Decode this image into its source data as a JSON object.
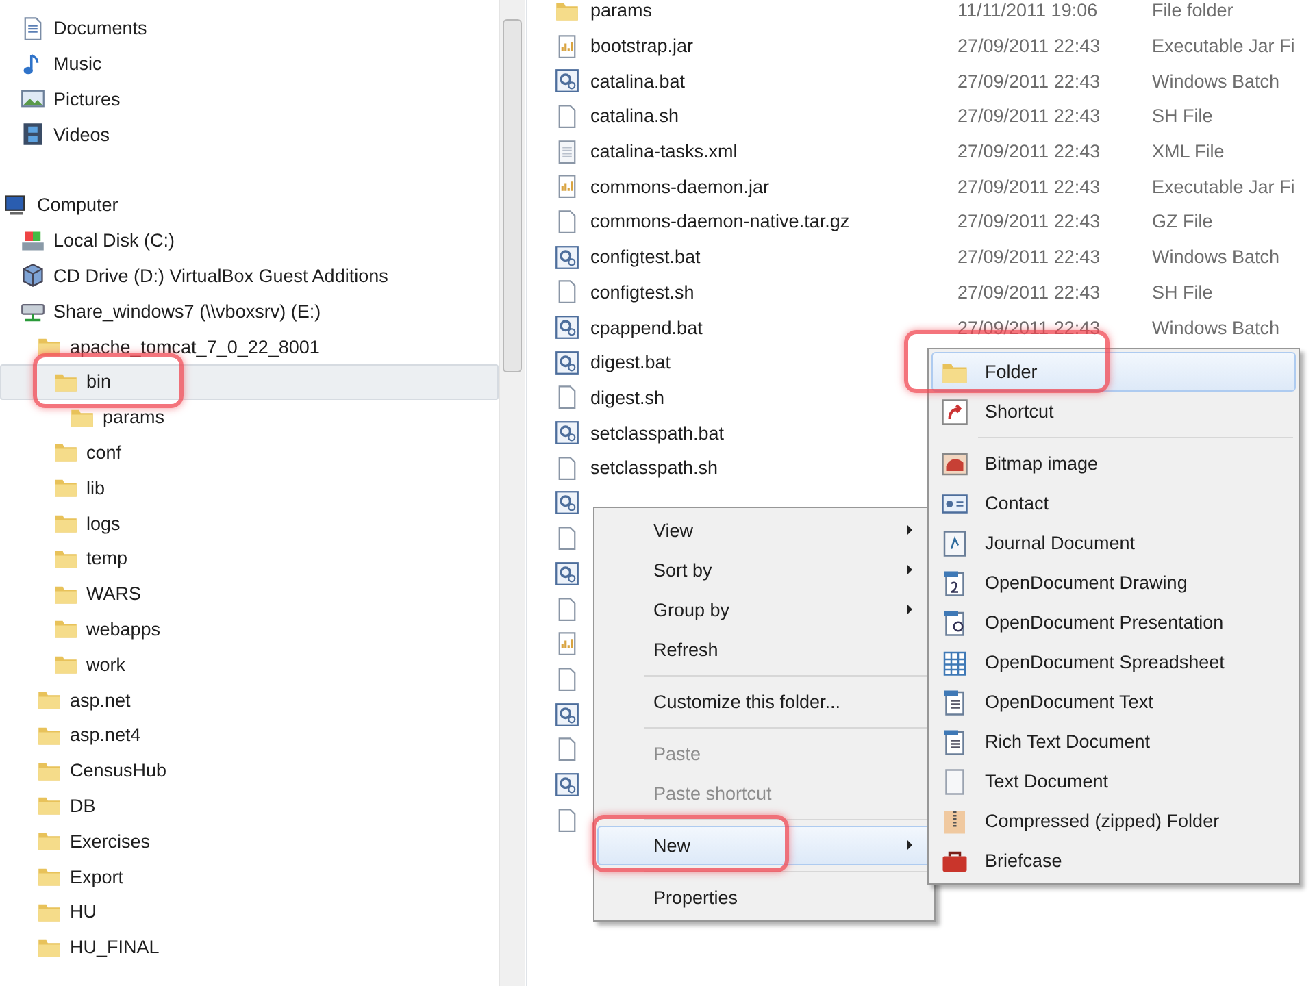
{
  "libraries_items": [
    {
      "label": "Documents",
      "kind": "document",
      "selected": false
    },
    {
      "label": "Music",
      "kind": "music",
      "selected": false
    },
    {
      "label": "Pictures",
      "kind": "pictures",
      "selected": false
    },
    {
      "label": "Videos",
      "kind": "videos",
      "selected": false
    }
  ],
  "computer": {
    "label": "Computer",
    "kind": "computer",
    "selected": false,
    "children": [
      {
        "label": "Local Disk (C:)",
        "kind": "disk",
        "selected": false
      },
      {
        "label": "CD Drive (D:) VirtualBox Guest Additions",
        "kind": "cd",
        "selected": false
      },
      {
        "label": "Share_windows7 (\\\\vboxsrv) (E:)",
        "kind": "network",
        "selected": false,
        "children": [
          {
            "label": "apache_tomcat_7_0_22_8001",
            "kind": "folder",
            "selected": false,
            "children": [
              {
                "label": "bin",
                "kind": "folder",
                "selected": true,
                "annotated": true,
                "children": [
                  {
                    "label": "params",
                    "kind": "folder",
                    "selected": false
                  }
                ]
              },
              {
                "label": "conf",
                "kind": "folder",
                "selected": false
              },
              {
                "label": "lib",
                "kind": "folder",
                "selected": false
              },
              {
                "label": "logs",
                "kind": "folder",
                "selected": false
              },
              {
                "label": "temp",
                "kind": "folder",
                "selected": false
              },
              {
                "label": "WARS",
                "kind": "folder",
                "selected": false
              },
              {
                "label": "webapps",
                "kind": "folder",
                "selected": false
              },
              {
                "label": "work",
                "kind": "folder",
                "selected": false
              }
            ]
          },
          {
            "label": "asp.net",
            "kind": "folder",
            "selected": false
          },
          {
            "label": "asp.net4",
            "kind": "folder",
            "selected": false
          },
          {
            "label": "CensusHub",
            "kind": "folder",
            "selected": false
          },
          {
            "label": "DB",
            "kind": "folder",
            "selected": false
          },
          {
            "label": "Exercises",
            "kind": "folder",
            "selected": false
          },
          {
            "label": "Export",
            "kind": "folder",
            "selected": false
          },
          {
            "label": "HU",
            "kind": "folder",
            "selected": false
          },
          {
            "label": "HU_FINAL",
            "kind": "folder",
            "selected": false
          }
        ]
      }
    ]
  },
  "files": [
    {
      "kind": "folder",
      "name": "params",
      "date": "11/11/2011 19:06",
      "type": "File folder"
    },
    {
      "kind": "jar",
      "name": "bootstrap.jar",
      "date": "27/09/2011 22:43",
      "type": "Executable Jar Fi"
    },
    {
      "kind": "bat",
      "name": "catalina.bat",
      "date": "27/09/2011 22:43",
      "type": "Windows Batch"
    },
    {
      "kind": "blank",
      "name": "catalina.sh",
      "date": "27/09/2011 22:43",
      "type": "SH File"
    },
    {
      "kind": "xml",
      "name": "catalina-tasks.xml",
      "date": "27/09/2011 22:43",
      "type": "XML File"
    },
    {
      "kind": "jar",
      "name": "commons-daemon.jar",
      "date": "27/09/2011 22:43",
      "type": "Executable Jar Fi"
    },
    {
      "kind": "blank",
      "name": "commons-daemon-native.tar.gz",
      "date": "27/09/2011 22:43",
      "type": "GZ File"
    },
    {
      "kind": "bat",
      "name": "configtest.bat",
      "date": "27/09/2011 22:43",
      "type": "Windows Batch"
    },
    {
      "kind": "blank",
      "name": "configtest.sh",
      "date": "27/09/2011 22:43",
      "type": "SH File"
    },
    {
      "kind": "bat",
      "name": "cpappend.bat",
      "date": "27/09/2011 22:43",
      "type": "Windows Batch"
    },
    {
      "kind": "bat",
      "name": "digest.bat"
    },
    {
      "kind": "blank",
      "name": "digest.sh"
    },
    {
      "kind": "bat",
      "name": "setclasspath.bat"
    },
    {
      "kind": "blank",
      "name": "setclasspath.sh"
    },
    {
      "kind": "bat"
    },
    {
      "kind": "blank"
    },
    {
      "kind": "bat"
    },
    {
      "kind": "blank"
    },
    {
      "kind": "jar"
    },
    {
      "kind": "blank"
    },
    {
      "kind": "bat"
    },
    {
      "kind": "blank"
    },
    {
      "kind": "bat"
    },
    {
      "kind": "blank"
    }
  ],
  "context_menu": [
    {
      "kind": "item",
      "label": "View",
      "submenu": true,
      "disabled": false,
      "selected": false
    },
    {
      "kind": "item",
      "label": "Sort by",
      "submenu": true,
      "disabled": false,
      "selected": false
    },
    {
      "kind": "item",
      "label": "Group by",
      "submenu": true,
      "disabled": false,
      "selected": false
    },
    {
      "kind": "item",
      "label": "Refresh",
      "submenu": false,
      "disabled": false,
      "selected": false
    },
    {
      "kind": "separator"
    },
    {
      "kind": "item",
      "label": "Customize this folder...",
      "submenu": false,
      "disabled": false,
      "selected": false
    },
    {
      "kind": "separator"
    },
    {
      "kind": "item",
      "label": "Paste",
      "submenu": false,
      "disabled": true,
      "selected": false
    },
    {
      "kind": "item",
      "label": "Paste shortcut",
      "submenu": false,
      "disabled": true,
      "selected": false
    },
    {
      "kind": "separator"
    },
    {
      "kind": "item",
      "label": "New",
      "submenu": true,
      "disabled": false,
      "selected": true,
      "annotated": true
    },
    {
      "kind": "separator"
    },
    {
      "kind": "item",
      "label": "Properties",
      "submenu": false,
      "disabled": false,
      "selected": false
    }
  ],
  "new_submenu": [
    {
      "kind": "folder",
      "label": "Folder",
      "selected": true,
      "annotated": true
    },
    {
      "kind": "shortcut",
      "label": "Shortcut",
      "selected": false
    },
    {
      "kind": "separator"
    },
    {
      "kind": "bitmap",
      "label": "Bitmap image",
      "selected": false
    },
    {
      "kind": "contact",
      "label": "Contact",
      "selected": false
    },
    {
      "kind": "journal",
      "label": "Journal Document",
      "selected": false
    },
    {
      "kind": "drawing",
      "label": "OpenDocument Drawing",
      "selected": false
    },
    {
      "kind": "presentation",
      "label": "OpenDocument Presentation",
      "selected": false
    },
    {
      "kind": "spreadsheet",
      "label": "OpenDocument Spreadsheet",
      "selected": false
    },
    {
      "kind": "text",
      "label": "OpenDocument Text",
      "selected": false
    },
    {
      "kind": "text",
      "label": "Rich Text Document",
      "selected": false
    },
    {
      "kind": "blank",
      "label": "Text Document",
      "selected": false
    },
    {
      "kind": "zip",
      "label": "Compressed (zipped) Folder",
      "selected": false
    },
    {
      "kind": "briefcase",
      "label": "Briefcase",
      "selected": false
    }
  ]
}
